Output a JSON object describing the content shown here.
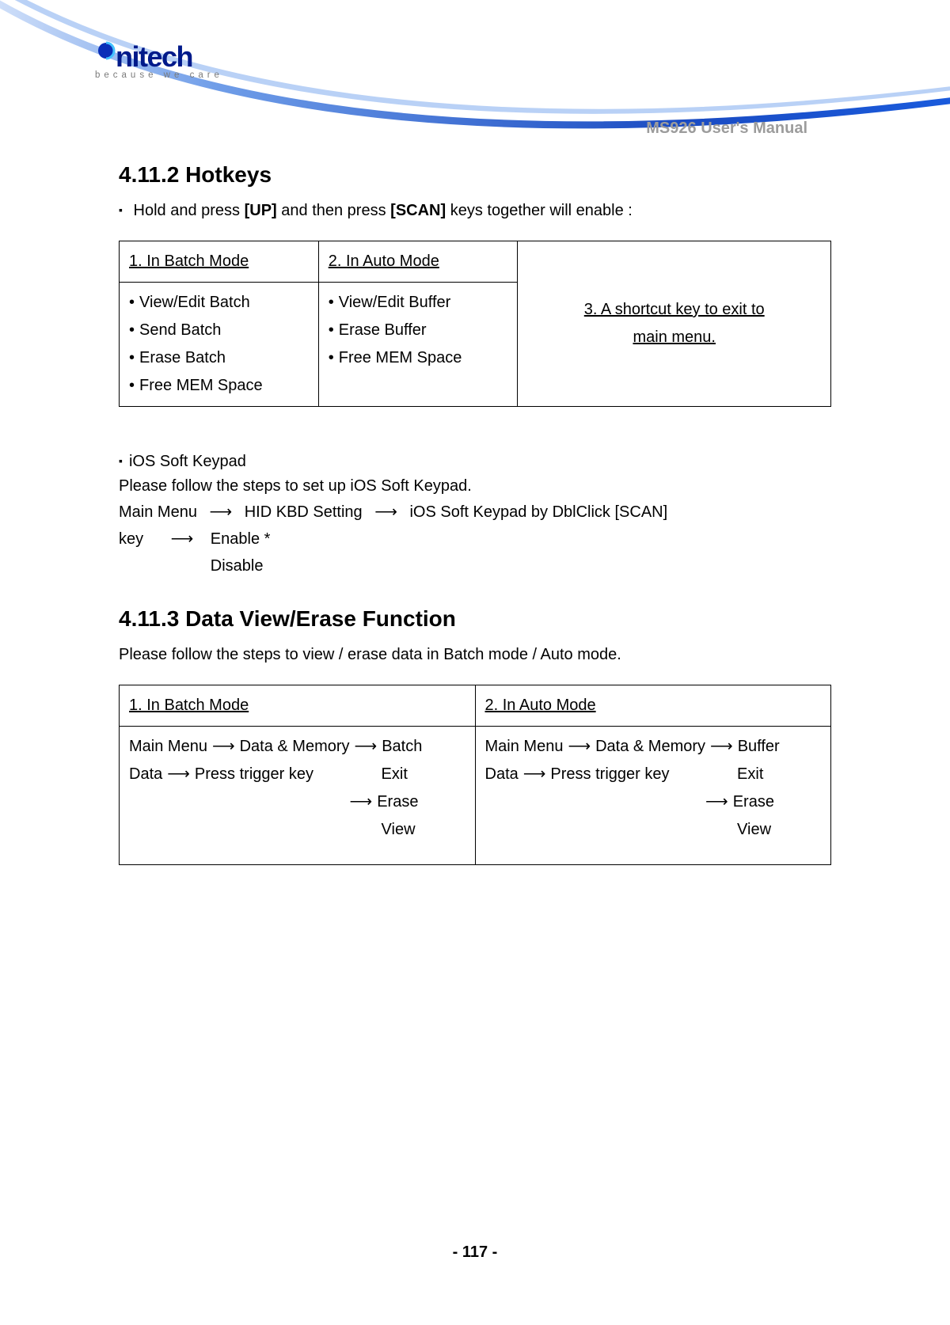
{
  "logo": {
    "brand_stylized": "nitech",
    "tagline": "because we care"
  },
  "doc_title": "MS926 User's Manual",
  "section1": {
    "heading": "4.11.2 Hotkeys",
    "hold_press_prefix": "Hold and press ",
    "up_key": "[UP]",
    "mid": " and then press ",
    "scan_key": "[SCAN]",
    "suffix": " keys together will enable :"
  },
  "table1": {
    "col1_head": "1. In Batch Mode",
    "col2_head": "2. In Auto Mode",
    "col3_text_line1": "3. A shortcut key to exit to",
    "col3_text_line2": "main menu.",
    "col1_items": [
      "View/Edit Batch",
      "Send Batch",
      "Erase Batch",
      "Free MEM Space"
    ],
    "col2_items": [
      "View/Edit Buffer",
      "Erase Buffer",
      "Free MEM Space"
    ]
  },
  "ios": {
    "title": "iOS Soft Keypad",
    "setup_line": "Please follow the steps to set up iOS Soft Keypad.",
    "path_main": "Main Menu",
    "path_hid": "HID KBD Setting",
    "path_ios": "iOS Soft Keypad by DblClick [SCAN]",
    "key_label": "key",
    "opt_enable": "Enable *",
    "opt_disable": "Disable"
  },
  "section2": {
    "heading": "4.11.3 Data View/Erase Function",
    "intro": "Please follow the steps to view / erase data in Batch mode / Auto mode."
  },
  "table2": {
    "col1_head": "1. In Batch Mode",
    "col2_head": "2. In Auto Mode",
    "batch": {
      "s1": "Main Menu",
      "s2": "Data & Memory",
      "s3": "Batch",
      "s4": "Data",
      "s5": "Press trigger key",
      "o1": "Exit",
      "o2": "Erase",
      "o3": "View"
    },
    "auto": {
      "s1": "Main Menu",
      "s2": "Data & Memory",
      "s3": "Buffer",
      "s4": "Data",
      "s5": "Press trigger key",
      "o1": "Exit",
      "o2": "Erase",
      "o3": "View"
    }
  },
  "footer": "- 117 -"
}
